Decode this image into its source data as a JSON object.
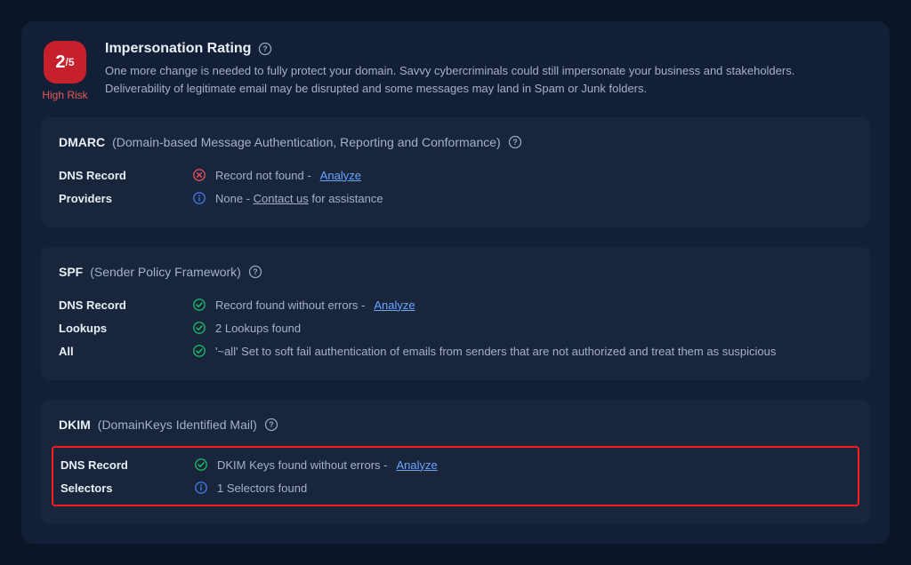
{
  "rating": {
    "score": "2",
    "scoreOutOf": "/5",
    "riskLabel": "High Risk",
    "title": "Impersonation Rating",
    "description": "One more change is needed to fully protect your domain. Savvy cybercriminals could still impersonate your business and stakeholders. Deliverability of legitimate email may be disrupted and some messages may land in Spam or Junk folders."
  },
  "dmarc": {
    "titleStrong": "DMARC",
    "titleSub": "(Domain-based Message Authentication, Reporting and Conformance)",
    "dnsLabel": "DNS Record",
    "dnsText": "Record not found -",
    "dnsLink": "Analyze",
    "providersLabel": "Providers",
    "providersPrefix": "None - ",
    "providersLink": "Contact us",
    "providersSuffix": " for assistance"
  },
  "spf": {
    "titleStrong": "SPF",
    "titleSub": "(Sender Policy Framework)",
    "dnsLabel": "DNS Record",
    "dnsText": "Record found without errors -",
    "dnsLink": "Analyze",
    "lookupsLabel": "Lookups",
    "lookupsText": "2 Lookups found",
    "allLabel": "All",
    "allText": "'~all' Set to soft fail authentication of emails from senders that are not authorized and treat them as suspicious"
  },
  "dkim": {
    "titleStrong": "DKIM",
    "titleSub": "(DomainKeys Identified Mail)",
    "dnsLabel": "DNS Record",
    "dnsText": "DKIM Keys found without errors -",
    "dnsLink": "Analyze",
    "selectorsLabel": "Selectors",
    "selectorsText": "1 Selectors found"
  }
}
